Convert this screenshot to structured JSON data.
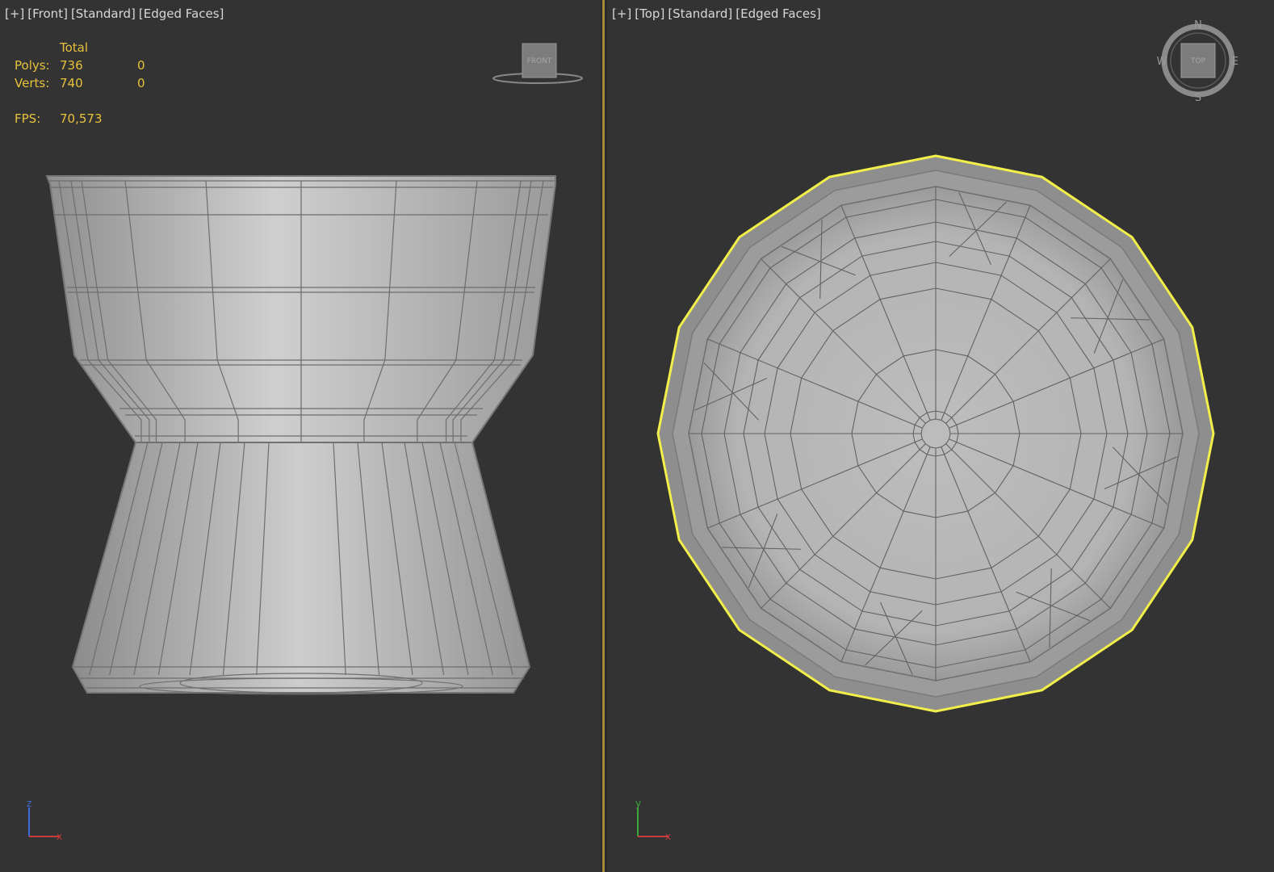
{
  "left_viewport": {
    "labels": [
      "[+]",
      "[Front]",
      "[Standard]",
      "[Edged Faces]"
    ],
    "stats": {
      "total_header": "Total",
      "polys_label": "Polys:",
      "polys_total": "736",
      "polys_selected": "0",
      "verts_label": "Verts:",
      "verts_total": "740",
      "verts_selected": "0",
      "fps_label": "FPS:",
      "fps_value": "70,573"
    },
    "viewcube_label": "FRONT",
    "axis": {
      "up": "z",
      "right": "x"
    }
  },
  "right_viewport": {
    "labels": [
      "[+]",
      "[Top]",
      "[Standard]",
      "[Edged Faces]"
    ],
    "viewcube_label": "TOP",
    "compass": {
      "n": "N",
      "s": "S",
      "e": "E",
      "w": "W"
    },
    "axis": {
      "up": "y",
      "right": "x"
    }
  },
  "colors": {
    "viewport_bg": "#333333",
    "stats_text": "#e8c23c",
    "selection": "#f2ef4a",
    "divider": "#a58a3a",
    "mesh": "#bdbdbd"
  }
}
